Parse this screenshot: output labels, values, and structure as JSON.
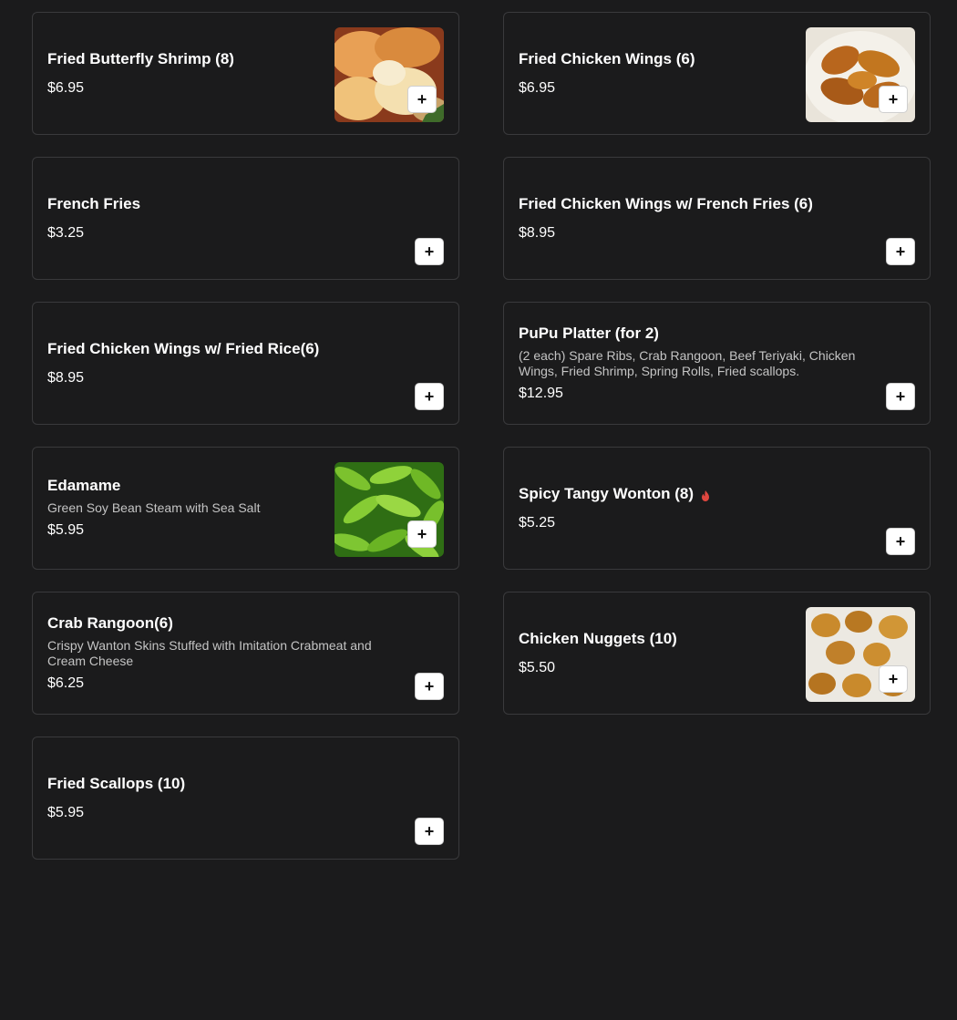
{
  "menu": {
    "items": [
      {
        "name": "Fried Butterfly Shrimp (8)",
        "price": "$6.95",
        "image": "fried-shrimp-photo"
      },
      {
        "name": "Fried Chicken Wings (6)",
        "price": "$6.95",
        "image": "chicken-wings-photo"
      },
      {
        "name": "French Fries",
        "price": "$3.25"
      },
      {
        "name": "Fried Chicken Wings w/ French Fries (6)",
        "price": "$8.95"
      },
      {
        "name": "Fried Chicken Wings w/ Fried Rice(6)",
        "price": "$8.95"
      },
      {
        "name": "PuPu Platter (for 2)",
        "description": "(2 each) Spare Ribs, Crab Rangoon, Beef Teriyaki, Chicken Wings, Fried Shrimp, Spring Rolls, Fried scallops.",
        "price": "$12.95"
      },
      {
        "name": "Edamame",
        "description": "Green Soy Bean Steam with Sea Salt",
        "price": "$5.95",
        "image": "edamame-photo"
      },
      {
        "name": "Spicy Tangy Wonton (8)",
        "price": "$5.25",
        "spicy": true
      },
      {
        "name": "Crab Rangoon(6)",
        "description": "Crispy Wanton Skins Stuffed with Imitation Crabmeat and Cream Cheese",
        "price": "$6.25"
      },
      {
        "name": "Chicken Nuggets (10)",
        "price": "$5.50",
        "image": "chicken-nuggets-photo"
      },
      {
        "name": "Fried Scallops (10)",
        "price": "$5.95"
      }
    ]
  },
  "icons": {
    "add": "plus-icon",
    "spicy": "flame-icon"
  },
  "colors": {
    "background": "#1b1b1c",
    "card_border": "#3a3a3c",
    "text": "#ffffff",
    "muted_text": "#c4c4c4",
    "spicy": "#e0473f"
  }
}
